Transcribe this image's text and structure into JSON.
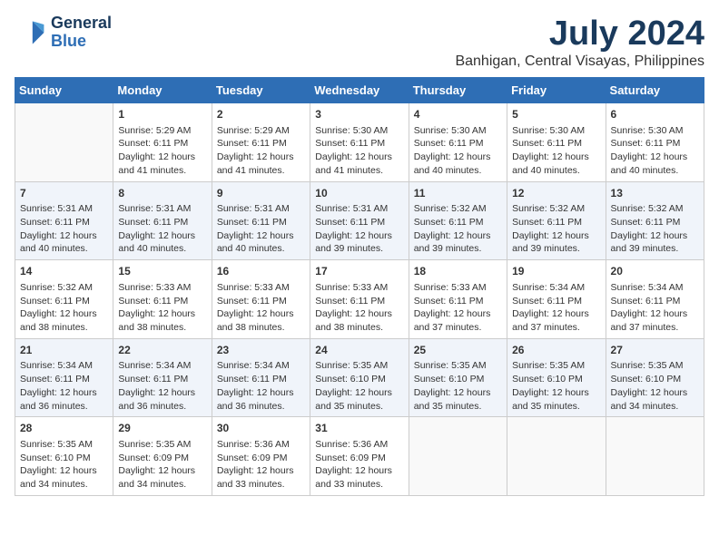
{
  "header": {
    "logo_line1": "General",
    "logo_line2": "Blue",
    "month": "July 2024",
    "location": "Banhigan, Central Visayas, Philippines"
  },
  "weekdays": [
    "Sunday",
    "Monday",
    "Tuesday",
    "Wednesday",
    "Thursday",
    "Friday",
    "Saturday"
  ],
  "weeks": [
    [
      {
        "day": "",
        "content": ""
      },
      {
        "day": "1",
        "content": "Sunrise: 5:29 AM\nSunset: 6:11 PM\nDaylight: 12 hours and 41 minutes."
      },
      {
        "day": "2",
        "content": "Sunrise: 5:29 AM\nSunset: 6:11 PM\nDaylight: 12 hours and 41 minutes."
      },
      {
        "day": "3",
        "content": "Sunrise: 5:30 AM\nSunset: 6:11 PM\nDaylight: 12 hours and 41 minutes."
      },
      {
        "day": "4",
        "content": "Sunrise: 5:30 AM\nSunset: 6:11 PM\nDaylight: 12 hours and 40 minutes."
      },
      {
        "day": "5",
        "content": "Sunrise: 5:30 AM\nSunset: 6:11 PM\nDaylight: 12 hours and 40 minutes."
      },
      {
        "day": "6",
        "content": "Sunrise: 5:30 AM\nSunset: 6:11 PM\nDaylight: 12 hours and 40 minutes."
      }
    ],
    [
      {
        "day": "7",
        "content": "Sunrise: 5:31 AM\nSunset: 6:11 PM\nDaylight: 12 hours and 40 minutes."
      },
      {
        "day": "8",
        "content": "Sunrise: 5:31 AM\nSunset: 6:11 PM\nDaylight: 12 hours and 40 minutes."
      },
      {
        "day": "9",
        "content": "Sunrise: 5:31 AM\nSunset: 6:11 PM\nDaylight: 12 hours and 40 minutes."
      },
      {
        "day": "10",
        "content": "Sunrise: 5:31 AM\nSunset: 6:11 PM\nDaylight: 12 hours and 39 minutes."
      },
      {
        "day": "11",
        "content": "Sunrise: 5:32 AM\nSunset: 6:11 PM\nDaylight: 12 hours and 39 minutes."
      },
      {
        "day": "12",
        "content": "Sunrise: 5:32 AM\nSunset: 6:11 PM\nDaylight: 12 hours and 39 minutes."
      },
      {
        "day": "13",
        "content": "Sunrise: 5:32 AM\nSunset: 6:11 PM\nDaylight: 12 hours and 39 minutes."
      }
    ],
    [
      {
        "day": "14",
        "content": "Sunrise: 5:32 AM\nSunset: 6:11 PM\nDaylight: 12 hours and 38 minutes."
      },
      {
        "day": "15",
        "content": "Sunrise: 5:33 AM\nSunset: 6:11 PM\nDaylight: 12 hours and 38 minutes."
      },
      {
        "day": "16",
        "content": "Sunrise: 5:33 AM\nSunset: 6:11 PM\nDaylight: 12 hours and 38 minutes."
      },
      {
        "day": "17",
        "content": "Sunrise: 5:33 AM\nSunset: 6:11 PM\nDaylight: 12 hours and 38 minutes."
      },
      {
        "day": "18",
        "content": "Sunrise: 5:33 AM\nSunset: 6:11 PM\nDaylight: 12 hours and 37 minutes."
      },
      {
        "day": "19",
        "content": "Sunrise: 5:34 AM\nSunset: 6:11 PM\nDaylight: 12 hours and 37 minutes."
      },
      {
        "day": "20",
        "content": "Sunrise: 5:34 AM\nSunset: 6:11 PM\nDaylight: 12 hours and 37 minutes."
      }
    ],
    [
      {
        "day": "21",
        "content": "Sunrise: 5:34 AM\nSunset: 6:11 PM\nDaylight: 12 hours and 36 minutes."
      },
      {
        "day": "22",
        "content": "Sunrise: 5:34 AM\nSunset: 6:11 PM\nDaylight: 12 hours and 36 minutes."
      },
      {
        "day": "23",
        "content": "Sunrise: 5:34 AM\nSunset: 6:11 PM\nDaylight: 12 hours and 36 minutes."
      },
      {
        "day": "24",
        "content": "Sunrise: 5:35 AM\nSunset: 6:10 PM\nDaylight: 12 hours and 35 minutes."
      },
      {
        "day": "25",
        "content": "Sunrise: 5:35 AM\nSunset: 6:10 PM\nDaylight: 12 hours and 35 minutes."
      },
      {
        "day": "26",
        "content": "Sunrise: 5:35 AM\nSunset: 6:10 PM\nDaylight: 12 hours and 35 minutes."
      },
      {
        "day": "27",
        "content": "Sunrise: 5:35 AM\nSunset: 6:10 PM\nDaylight: 12 hours and 34 minutes."
      }
    ],
    [
      {
        "day": "28",
        "content": "Sunrise: 5:35 AM\nSunset: 6:10 PM\nDaylight: 12 hours and 34 minutes."
      },
      {
        "day": "29",
        "content": "Sunrise: 5:35 AM\nSunset: 6:09 PM\nDaylight: 12 hours and 34 minutes."
      },
      {
        "day": "30",
        "content": "Sunrise: 5:36 AM\nSunset: 6:09 PM\nDaylight: 12 hours and 33 minutes."
      },
      {
        "day": "31",
        "content": "Sunrise: 5:36 AM\nSunset: 6:09 PM\nDaylight: 12 hours and 33 minutes."
      },
      {
        "day": "",
        "content": ""
      },
      {
        "day": "",
        "content": ""
      },
      {
        "day": "",
        "content": ""
      }
    ]
  ]
}
